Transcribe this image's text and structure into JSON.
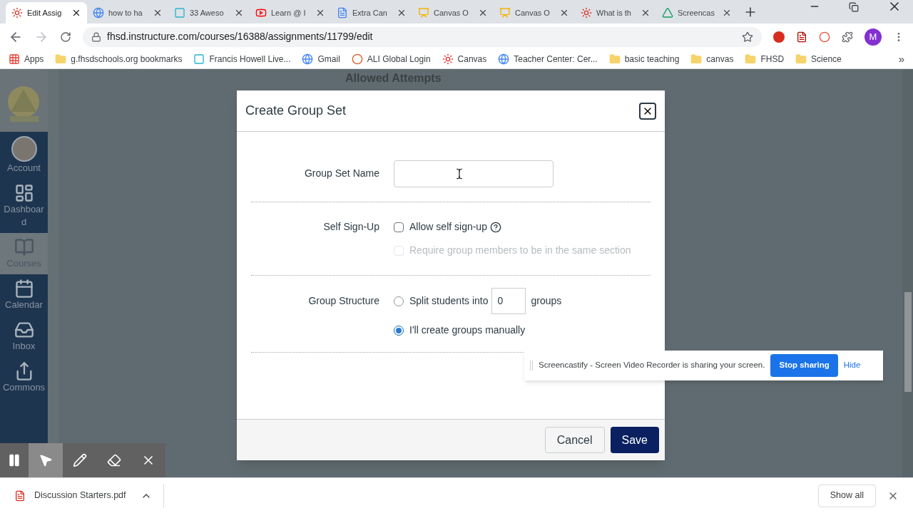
{
  "tabs": [
    {
      "title": "Edit Assig",
      "selected": true,
      "kind": "canvas"
    },
    {
      "title": "how to ha",
      "selected": false,
      "kind": "google"
    },
    {
      "title": "33 Aweso",
      "selected": false,
      "kind": "site"
    },
    {
      "title": "Learn @ I",
      "selected": false,
      "kind": "youtube"
    },
    {
      "title": "Extra Can",
      "selected": false,
      "kind": "doc"
    },
    {
      "title": "Canvas O",
      "selected": false,
      "kind": "slides"
    },
    {
      "title": "Canvas O",
      "selected": false,
      "kind": "slides"
    },
    {
      "title": "What is th",
      "selected": false,
      "kind": "canvas"
    },
    {
      "title": "Screencas",
      "selected": false,
      "kind": "drive"
    }
  ],
  "address": "fhsd.instructure.com/courses/16388/assignments/11799/edit",
  "profile_initial": "M",
  "bookmarks": [
    {
      "label": "Apps",
      "kind": "apps"
    },
    {
      "label": "g.fhsdschools.org bookmarks",
      "kind": "folder"
    },
    {
      "label": "Francis Howell Live...",
      "kind": "site"
    },
    {
      "label": "Gmail",
      "kind": "google"
    },
    {
      "label": "ALI Global Login",
      "kind": "dots"
    },
    {
      "label": "Canvas",
      "kind": "canvas"
    },
    {
      "label": "Teacher Center: Cer...",
      "kind": "google"
    },
    {
      "label": "basic teaching",
      "kind": "folder"
    },
    {
      "label": "canvas",
      "kind": "folder"
    },
    {
      "label": "FHSD",
      "kind": "folder"
    },
    {
      "label": "Science",
      "kind": "folder"
    }
  ],
  "bookmarks_more": "»",
  "nav": [
    {
      "label": "Account",
      "kind": "avatar",
      "selected": false
    },
    {
      "label": "Dashboard",
      "kind": "dashboard",
      "selected": false
    },
    {
      "label": "Courses",
      "kind": "courses",
      "selected": true
    },
    {
      "label": "Calendar",
      "kind": "calendar",
      "selected": false
    },
    {
      "label": "Inbox",
      "kind": "inbox",
      "selected": false
    },
    {
      "label": "Commons",
      "kind": "commons",
      "selected": false
    }
  ],
  "background_heading": "Allowed Attempts",
  "modal": {
    "title": "Create Group Set",
    "name_label": "Group Set Name",
    "sign_up_label": "Self Sign-Up",
    "sign_up_options": [
      {
        "label": "Allow self sign-up",
        "checked": false,
        "disabled": false
      },
      {
        "label": "Require group members to be in the same section",
        "checked": false,
        "disabled": true
      }
    ],
    "structure_label": "Group Structure",
    "structure_options": [
      {
        "kind": "split",
        "label": "Split students into",
        "count": "0",
        "suffix": "groups",
        "selected": false
      },
      {
        "kind": "manual",
        "label": "I'll create groups manually",
        "selected": true
      }
    ],
    "buttons": [
      {
        "label": "Cancel",
        "primary": false
      },
      {
        "label": "Save",
        "primary": true
      }
    ]
  },
  "sharing_bar": {
    "message": "Screencastify - Screen Video Recorder is sharing your screen.",
    "stop": "Stop sharing",
    "hide": "Hide"
  },
  "annotation_tools": [
    {
      "kind": "pause",
      "selected": false
    },
    {
      "kind": "pointer",
      "selected": true
    },
    {
      "kind": "pen",
      "selected": false
    },
    {
      "kind": "eraser",
      "selected": false
    },
    {
      "kind": "close",
      "selected": false
    }
  ],
  "downloads": {
    "file": "Discussion Starters.pdf",
    "show_all": "Show all"
  }
}
